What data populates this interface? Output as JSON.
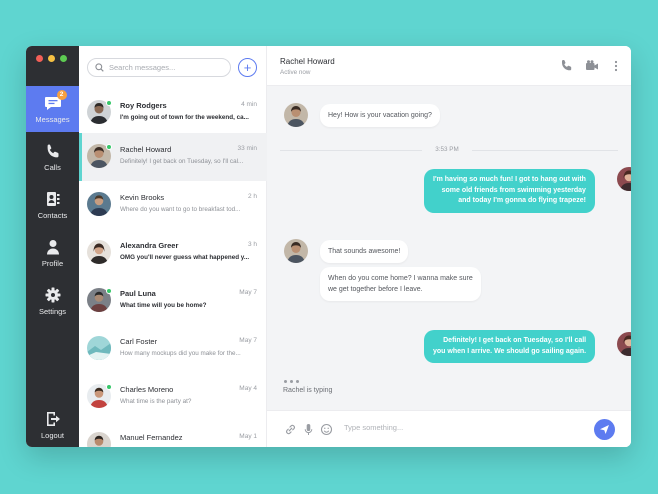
{
  "colors": {
    "background": "#5fd5d0",
    "nav_bg": "#2d2f33",
    "accent": "#5d7bf0",
    "bubble_out": "#42d1cb",
    "online": "#37c76a",
    "badge": "#f6a040"
  },
  "nav": {
    "items": [
      {
        "label": "Messages",
        "icon": "chat-bubble-icon",
        "badge": "2",
        "active": true
      },
      {
        "label": "Calls",
        "icon": "phone-icon"
      },
      {
        "label": "Contacts",
        "icon": "contacts-icon"
      },
      {
        "label": "Profile",
        "icon": "person-icon"
      },
      {
        "label": "Settings",
        "icon": "gear-icon"
      }
    ],
    "logout": {
      "label": "Logout",
      "icon": "logout-icon"
    }
  },
  "search": {
    "placeholder": "Search messages...",
    "icon": "search-icon"
  },
  "add_button": {
    "label": "+",
    "icon": "plus-icon"
  },
  "conversations": [
    {
      "name": "Roy Rodgers",
      "time": "4 min",
      "preview": "I'm going out of town for the weekend, ca...",
      "unread": true,
      "online": true
    },
    {
      "name": "Rachel Howard",
      "time": "33 min",
      "preview": "Definitely! I get back on Tuesday, so I'll cal...",
      "unread": false,
      "online": true,
      "active": true
    },
    {
      "name": "Kevin Brooks",
      "time": "2 h",
      "preview": "Where do you want to go to breakfast tod...",
      "unread": false,
      "online": false
    },
    {
      "name": "Alexandra Greer",
      "time": "3 h",
      "preview": "OMG you'll never guess what happened y...",
      "unread": true,
      "online": false
    },
    {
      "name": "Paul Luna",
      "time": "May 7",
      "preview": "What time will you be home?",
      "unread": true,
      "online": true
    },
    {
      "name": "Carl Foster",
      "time": "May 7",
      "preview": "How many mockups did you make for the...",
      "unread": false,
      "online": false
    },
    {
      "name": "Charles Moreno",
      "time": "May 4",
      "preview": "What time is the party at?",
      "unread": false,
      "online": true
    },
    {
      "name": "Manuel Fernandez",
      "time": "May 1",
      "preview": "",
      "unread": false,
      "online": false
    }
  ],
  "chat": {
    "contact_name": "Rachel Howard",
    "status": "Active now",
    "header_icons": [
      "phone-icon",
      "video-camera-icon",
      "more-vertical-icon"
    ],
    "divider_time": "3:53 PM",
    "messages": [
      {
        "from": "them",
        "text": "Hey! How is your vacation going?"
      },
      {
        "from": "me",
        "lines": [
          "I'm having so much fun! I got to hang out with",
          "some old friends from swimming yesterday",
          "and today I'm gonna do flying trapeze!"
        ]
      },
      {
        "from": "them",
        "text": "That sounds awesome!"
      },
      {
        "from": "them",
        "lines": [
          "When do you come home? I wanna make sure",
          "we get together before I leave."
        ]
      },
      {
        "from": "me",
        "lines": [
          "Definitely! I get back on Tuesday, so I'll call",
          "you when I arrive. We should go sailing again."
        ]
      }
    ],
    "typing": "Rachel is typing"
  },
  "composer": {
    "placeholder": "Type something...",
    "icons": [
      "link-icon",
      "microphone-icon",
      "emoji-icon"
    ],
    "send_icon": "send-icon"
  }
}
